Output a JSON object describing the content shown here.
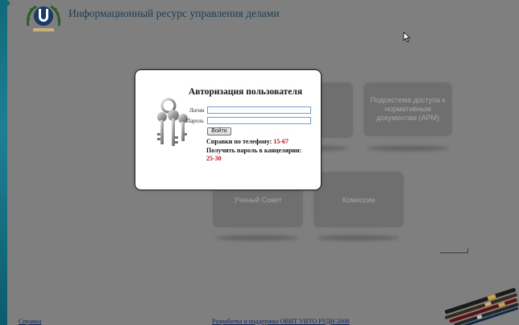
{
  "header": {
    "title": "Информационный ресурс управления делами"
  },
  "tiles": [
    {
      "label": ""
    },
    {
      "label": "Подсистема доступа к нормативным документам (АРМ)"
    },
    {
      "label": "Ученый Совет"
    },
    {
      "label": "Комиссии"
    }
  ],
  "modal": {
    "title": "Авторизация пользователя",
    "login_label": "Логин",
    "login_value": "",
    "password_label": "Пароль",
    "password_value": "",
    "submit_label": "Войти",
    "phone_text": "Справки по телефону:",
    "phone_number": "15-67",
    "office_text": "Получить пароль в канцелярии:",
    "office_number": "25-30"
  },
  "footer": {
    "help_link": "Справка",
    "credits_link": "Разработка и поддержка ОВИТ УИТО РУДН 2008"
  },
  "colors": {
    "overlay": "#7f7f7f",
    "accent_red": "#c0101b",
    "title_blue": "#1f3d52",
    "strip": "#0f6a7a"
  },
  "icons": [
    "university-logo-icon",
    "keys-icon",
    "pens-icon",
    "mouse-cursor-icon"
  ]
}
